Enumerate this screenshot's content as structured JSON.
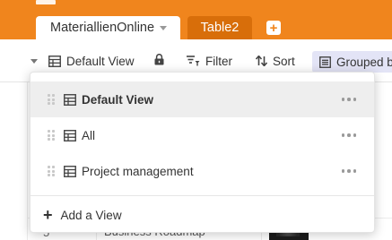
{
  "tabs": [
    {
      "label": "MateriallienOnline",
      "active": true
    },
    {
      "label": "Table2",
      "active": false
    }
  ],
  "tab_add_label": "+",
  "toolbar": {
    "view_label": "Default View",
    "filter_label": "Filter",
    "sort_label": "Sort",
    "grouped_label": "Grouped by"
  },
  "views_menu": {
    "items": [
      {
        "label": "Default View",
        "active": true
      },
      {
        "label": "All",
        "active": false
      },
      {
        "label": "Project management",
        "active": false
      }
    ],
    "add_view_label": "Add a View",
    "add_view_symbol": "+"
  },
  "background_row": {
    "number": "5",
    "text": "Business Roadmap"
  },
  "colors": {
    "header_orange": "#f0851d",
    "inactive_tab": "#d86e0a",
    "grouped_bg": "#e3e4f6",
    "active_item_bg": "#eeeeee"
  }
}
